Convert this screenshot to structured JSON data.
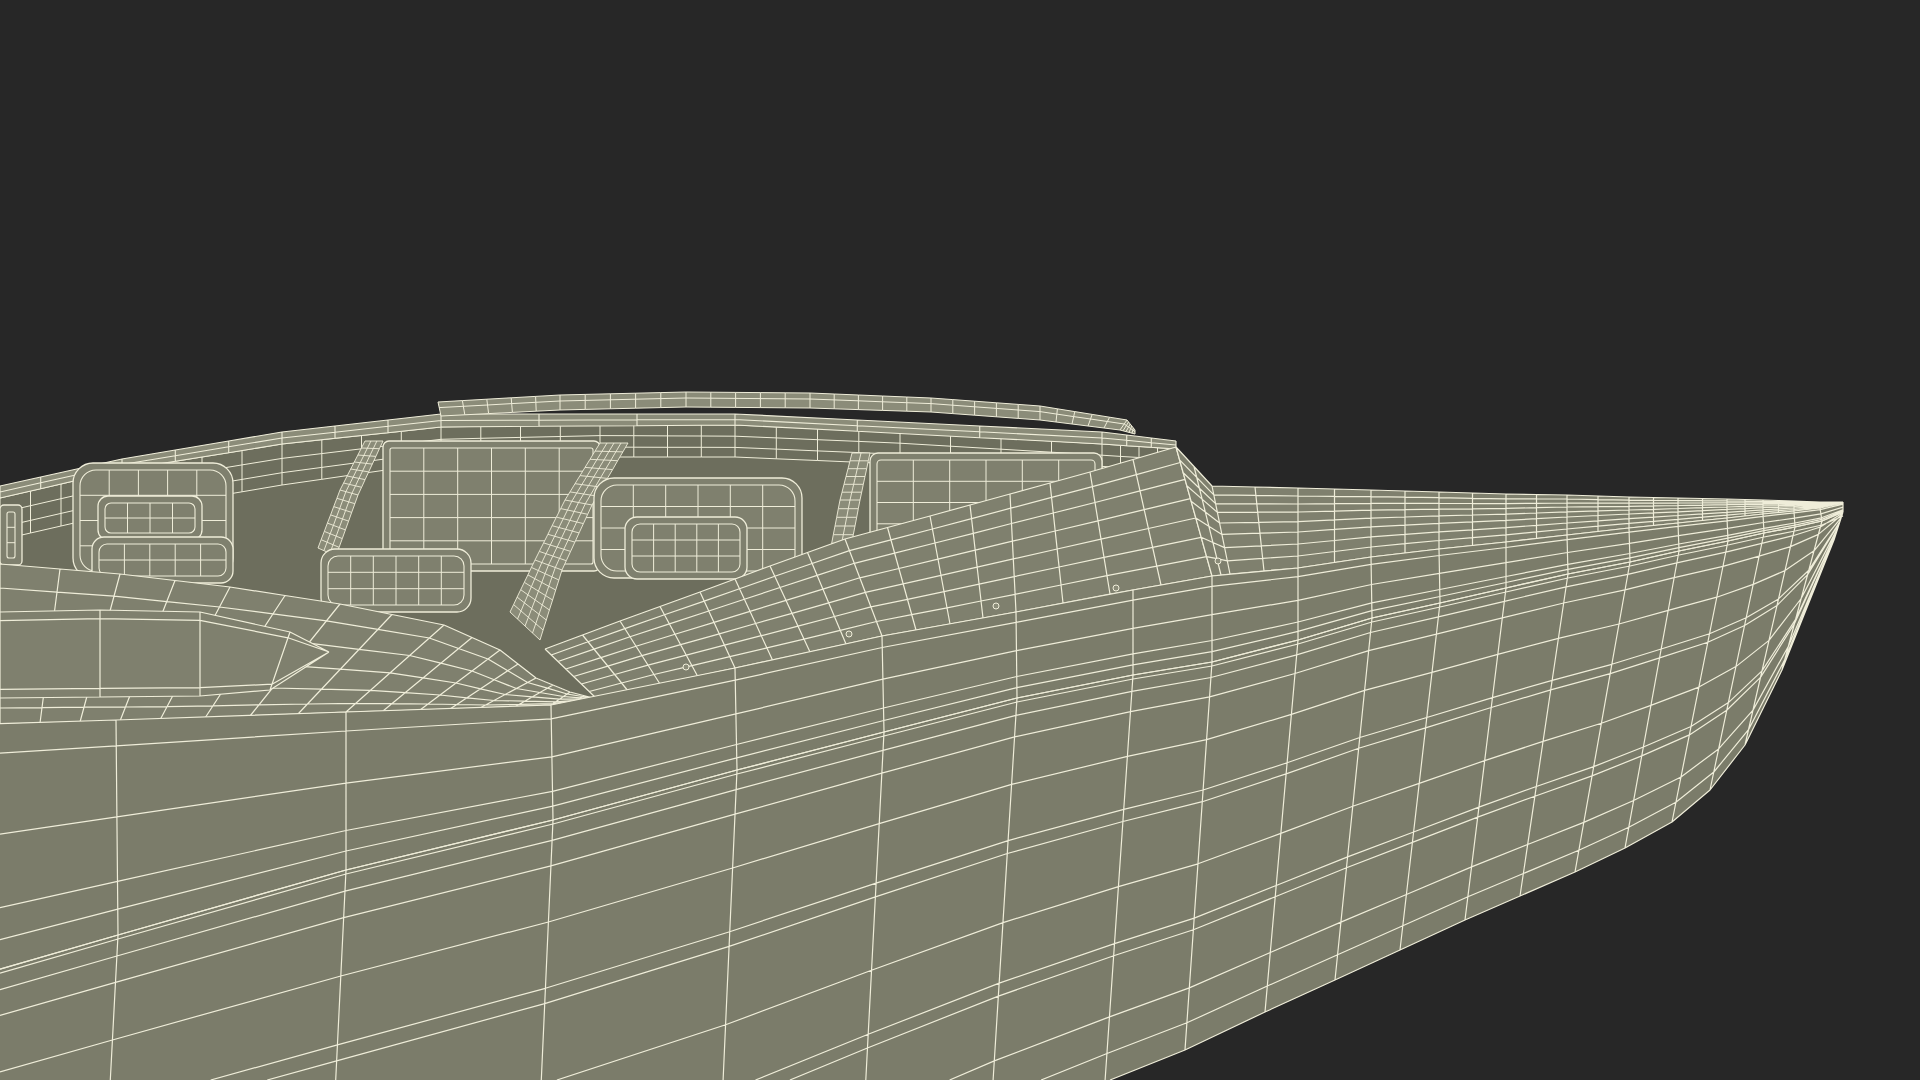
{
  "viewport": {
    "wireframe": true
  }
}
